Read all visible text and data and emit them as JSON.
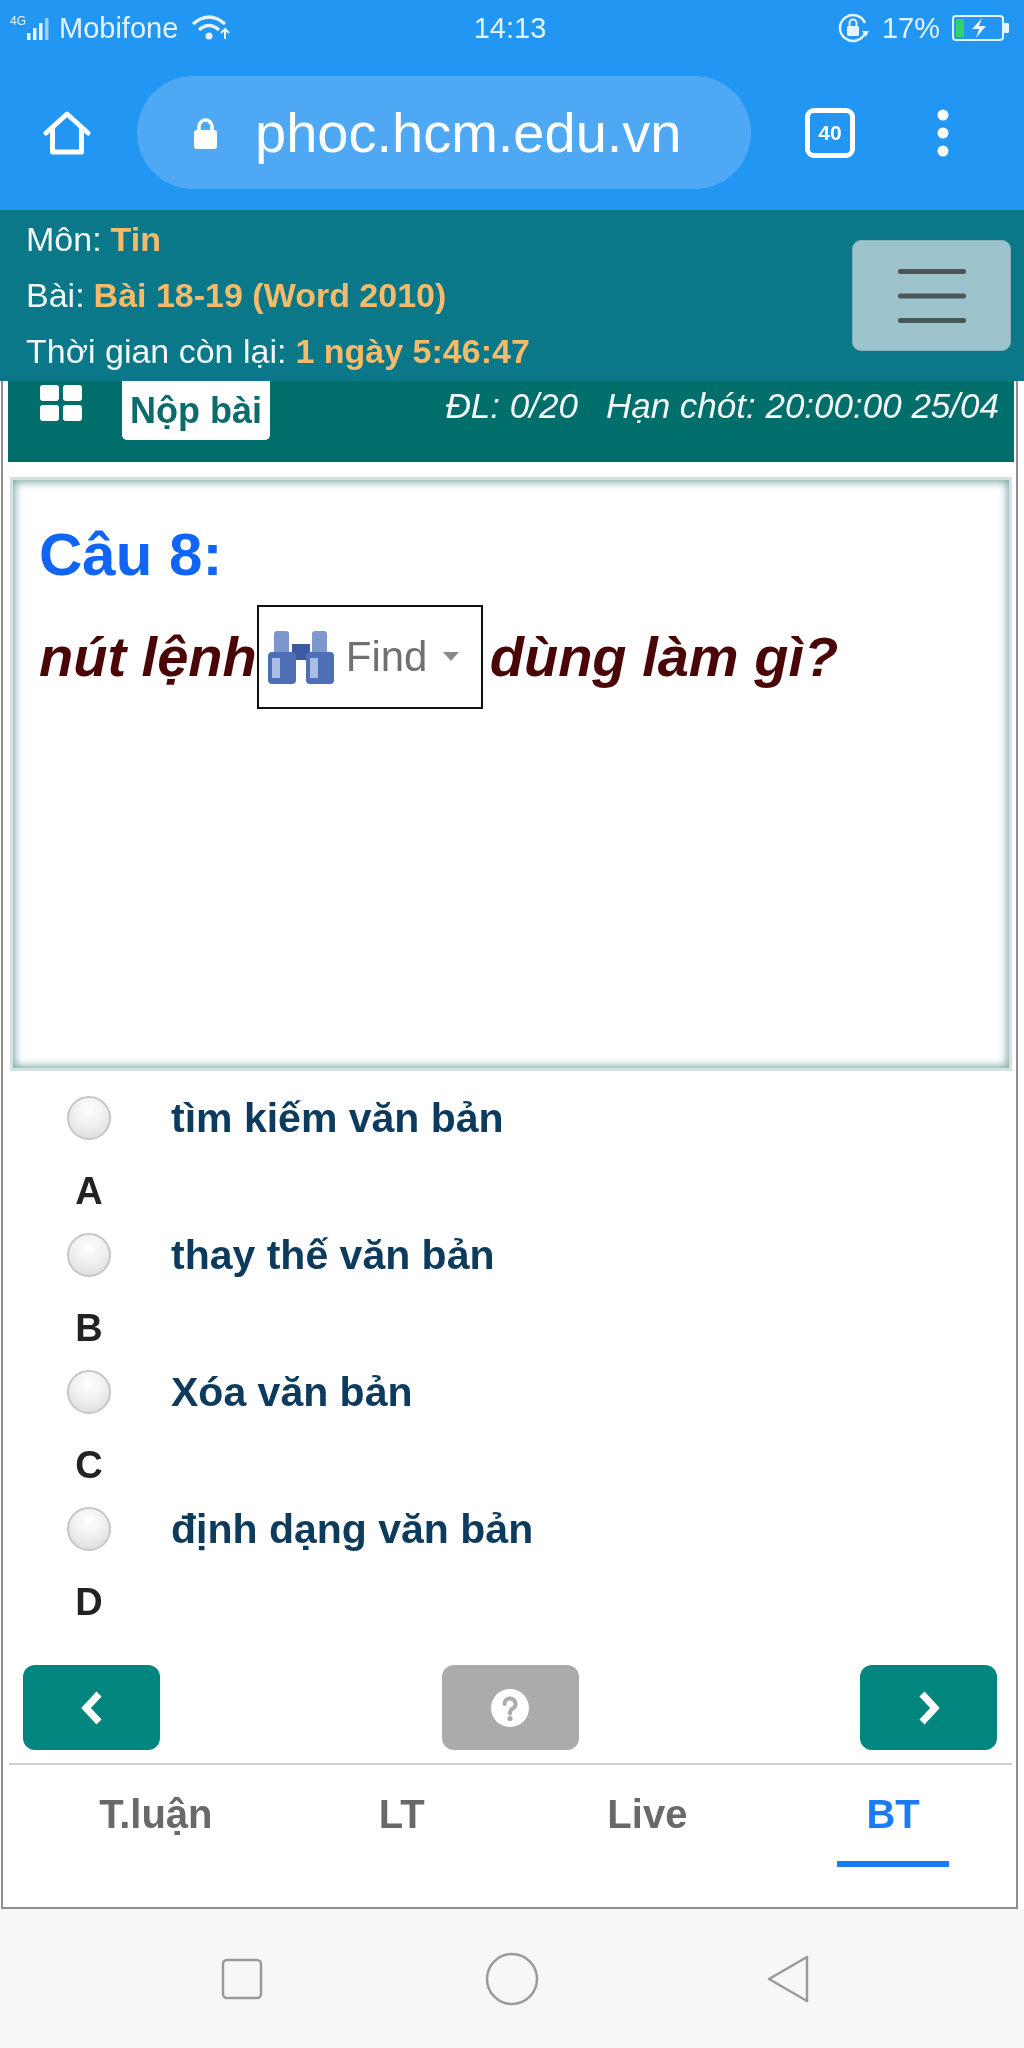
{
  "status_bar": {
    "network_type": "4G",
    "carrier": "Mobifone",
    "time": "14:13",
    "battery": "17%"
  },
  "browser": {
    "url": "phoc.hcm.edu.vn",
    "tab_count": "40"
  },
  "header": {
    "fields": [
      {
        "label": "Môn:",
        "value": "Tin"
      },
      {
        "label": "Bài:",
        "value": "Bài 18-19 (Word 2010)"
      },
      {
        "label": "Thời gian còn lại:",
        "value": "1 ngày 5:46:47"
      }
    ]
  },
  "toolbar": {
    "submit_button": "Nộp bài",
    "answered": "ĐL: 0/20",
    "deadline": "Hạn chót: 20:00:00 25/04"
  },
  "question": {
    "title": "Câu 8:",
    "text_before_image": "nút lệnh",
    "inline_image": {
      "label": "Find"
    },
    "text_after_image": "dùng làm gì?"
  },
  "options": [
    {
      "text": "tìm kiếm văn bản",
      "letter": "A",
      "selected": false
    },
    {
      "text": "thay thế văn bản",
      "letter": "B",
      "selected": false
    },
    {
      "text": "Xóa văn bản",
      "letter": "C",
      "selected": false
    },
    {
      "text": "định dạng văn bản",
      "letter": "D",
      "selected": false
    }
  ],
  "tabs": [
    {
      "label": "T.luận",
      "selected": false
    },
    {
      "label": "LT",
      "selected": false
    },
    {
      "label": "Live",
      "selected": false
    },
    {
      "label": "BT",
      "selected": true
    }
  ]
}
